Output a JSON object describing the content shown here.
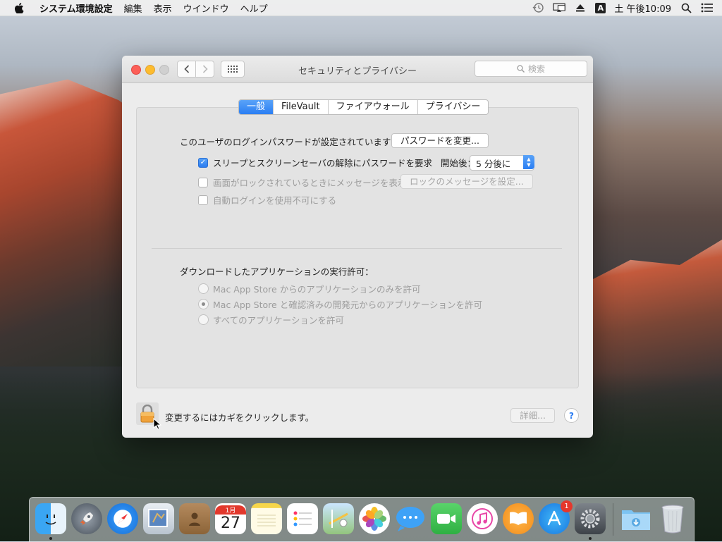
{
  "menubar": {
    "app_name": "システム環境設定",
    "menus": [
      "編集",
      "表示",
      "ウインドウ",
      "ヘルプ"
    ],
    "clock": "土 午後10:09",
    "input_indicator": "A"
  },
  "window": {
    "title": "セキュリティとプライバシー",
    "search_placeholder": "検索",
    "tabs": [
      "一般",
      "FileVault",
      "ファイアウォール",
      "プライバシー"
    ],
    "active_tab": "一般"
  },
  "general": {
    "password_set_label": "このユーザのログインパスワードが設定されています",
    "change_password_button": "パスワードを変更...",
    "require_password_label": "スリープとスクリーンセーバの解除にパスワードを要求",
    "require_password_checked": true,
    "start_label": "開始後：",
    "start_value": "5 分後に",
    "show_message_label": "画面がロックされているときにメッセージを表示",
    "set_lock_message_button": "ロックのメッセージを設定...",
    "disable_autologin_label": "自動ログインを使用不可にする",
    "download_apps_label": "ダウンロードしたアプリケーションの実行許可：",
    "allow_options": [
      "Mac App Store からのアプリケーションのみを許可",
      "Mac App Store と確認済みの開発元からのアプリケーションを許可",
      "すべてのアプリケーションを許可"
    ],
    "allow_selected_index": 1
  },
  "footer": {
    "lock_text": "変更するにはカギをクリックします。",
    "details_button": "詳細...",
    "help_button": "?"
  },
  "dock": {
    "calendar_month": "1月",
    "calendar_day": "27",
    "appstore_badge": "1"
  },
  "colors": {
    "accent": "#2a7ef3",
    "close": "#fc5f57",
    "minimize": "#fdbc2e"
  }
}
